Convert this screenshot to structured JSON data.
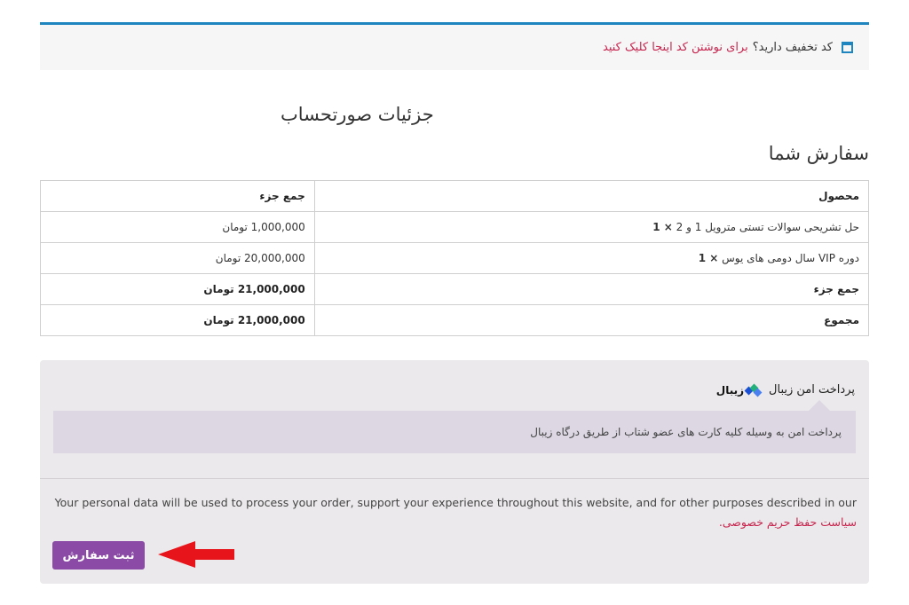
{
  "coupon": {
    "question": "کد تخفیف دارید؟",
    "link": "برای نوشتن کد اینجا کلیک کنید"
  },
  "billing_title": "جزئیات صورتحساب",
  "order_title": "سفارش شما",
  "table": {
    "headers": {
      "product": "محصول",
      "subtotal": "جمع جزء"
    },
    "items": [
      {
        "name": "حل تشریحی سوالات تستی مترویل 1 و 2",
        "qty": "× 1",
        "price": "1,000,000 تومان"
      },
      {
        "name": "دوره VIP سال دومی های یوس",
        "qty": "× 1",
        "price": "20,000,000 تومان"
      }
    ],
    "subtotal_label": "جمع جزء",
    "subtotal_value": "21,000,000 تومان",
    "total_label": "مجموع",
    "total_value": "21,000,000 تومان"
  },
  "payment": {
    "method_label": "پرداخت امن زیبال",
    "logo_text": "زیبال",
    "description": "پرداخت امن به وسیله کلیه کارت های عضو شتاب از طریق درگاه زیبال",
    "privacy_text": "Your personal data will be used to process your order, support your experience throughout this website, and for other purposes described in our",
    "privacy_link": "سیاست حفظ حریم خصوصی.",
    "place_order": "ثبت سفارش"
  },
  "colors": {
    "accent": "#1e85be",
    "link": "#c7254e",
    "button": "#8a4aa6",
    "arrow": "#e8141b"
  }
}
